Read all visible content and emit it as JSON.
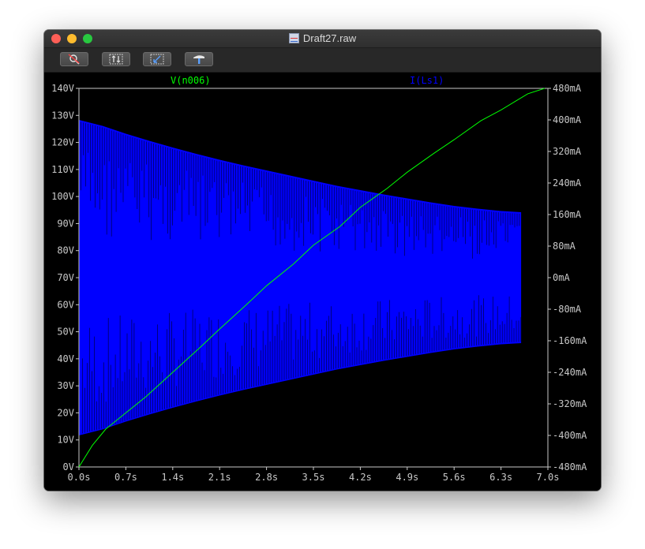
{
  "window": {
    "title": "Draft27.raw"
  },
  "toolbar": {
    "buttons": [
      {
        "icon": "zoom-cancel-icon"
      },
      {
        "icon": "autorange-icon"
      },
      {
        "icon": "zoom-back-icon"
      },
      {
        "icon": "probe-hammer-icon"
      }
    ]
  },
  "colors": {
    "voltage": "#00ff00",
    "current": "#0000ff",
    "axis": "#c8c8c8",
    "background": "#000000"
  },
  "chart_data": {
    "type": "line",
    "grid": false,
    "xlim": [
      0.0,
      7.0
    ],
    "ylim_left": [
      0,
      140
    ],
    "ylim_right": [
      -480,
      480
    ],
    "x_ticks": [
      "0.0s",
      "0.7s",
      "1.4s",
      "2.1s",
      "2.8s",
      "3.5s",
      "4.2s",
      "4.9s",
      "5.6s",
      "6.3s",
      "7.0s"
    ],
    "y_ticks_left": [
      "0V",
      "10V",
      "20V",
      "30V",
      "40V",
      "50V",
      "60V",
      "70V",
      "80V",
      "90V",
      "100V",
      "110V",
      "120V",
      "130V",
      "140V"
    ],
    "y_ticks_right": [
      "-480mA",
      "-400mA",
      "-320mA",
      "-240mA",
      "-160mA",
      "-80mA",
      "0mA",
      "80mA",
      "160mA",
      "240mA",
      "320mA",
      "400mA",
      "480mA"
    ],
    "series": [
      {
        "name": "V(n006)",
        "axis": "left",
        "x": [
          0.0,
          0.2,
          0.4,
          0.7,
          1.0,
          1.4,
          1.8,
          2.1,
          2.5,
          2.8,
          3.2,
          3.5,
          3.9,
          4.2,
          4.6,
          4.9,
          5.3,
          5.6,
          6.0,
          6.3,
          6.7,
          6.95
        ],
        "y": [
          0,
          8,
          14,
          20,
          26,
          35,
          44,
          51,
          60,
          67,
          75,
          82,
          89,
          96,
          103,
          109,
          116,
          121,
          128,
          132,
          138,
          140
        ]
      },
      {
        "name": "I(Ls1)",
        "axis": "right",
        "envelope_x": [
          0.0,
          0.35,
          0.7,
          1.05,
          1.4,
          1.75,
          2.1,
          2.45,
          2.8,
          3.15,
          3.5,
          3.85,
          4.2,
          4.55,
          4.9,
          5.25,
          5.6,
          5.95,
          6.3,
          6.6
        ],
        "envelope_upper": [
          400,
          385,
          365,
          347,
          330,
          314,
          299,
          285,
          272,
          259,
          246,
          233,
          222,
          211,
          201,
          191,
          182,
          175,
          169,
          166
        ],
        "envelope_lower": [
          -400,
          -385,
          -365,
          -347,
          -330,
          -314,
          -299,
          -285,
          -272,
          -259,
          -246,
          -233,
          -222,
          -211,
          -201,
          -191,
          -182,
          -175,
          -169,
          -166
        ]
      }
    ]
  }
}
